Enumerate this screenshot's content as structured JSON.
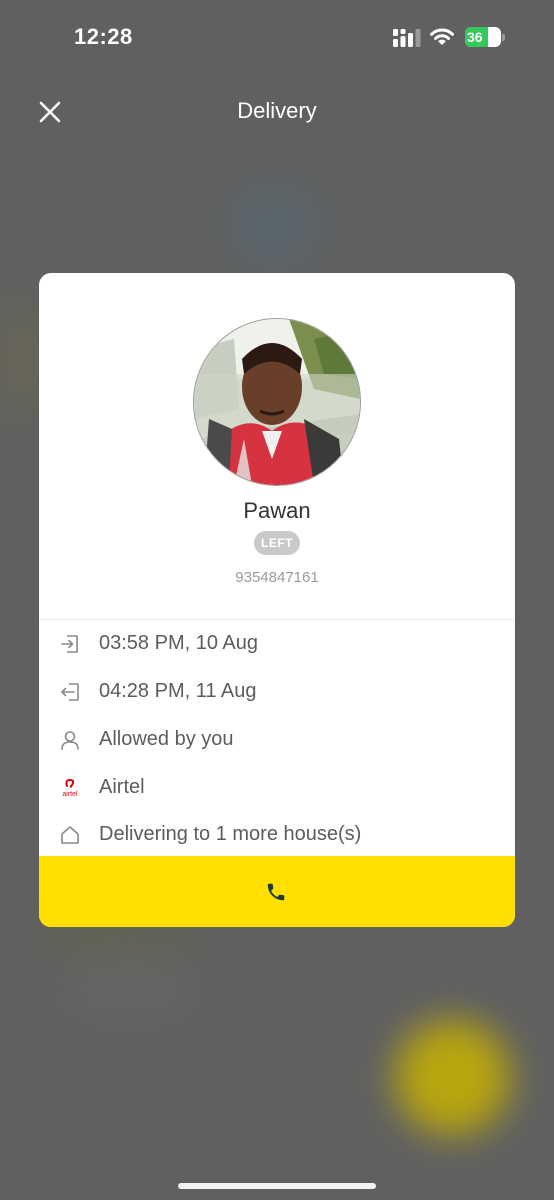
{
  "status_bar": {
    "time": "12:28",
    "battery": "36",
    "battery_color": "#34c759"
  },
  "header": {
    "title": "Delivery",
    "close_icon": "close-icon"
  },
  "visitor": {
    "name": "Pawan",
    "status": "LEFT",
    "phone": "9354847161"
  },
  "details": {
    "entry_time": "03:58 PM, 10 Aug",
    "exit_time": "04:28 PM, 11 Aug",
    "approved_by": "Allowed by you",
    "company": "Airtel",
    "company_logo_text": "airtel",
    "houses": "Delivering to 1 more house(s)"
  },
  "actions": {
    "call_icon": "phone-icon",
    "call_color": "#ffe000"
  }
}
